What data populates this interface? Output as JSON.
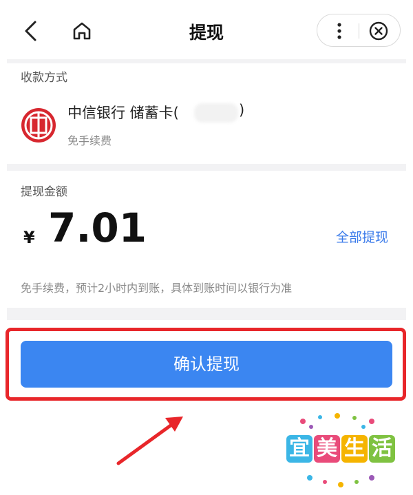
{
  "header": {
    "title": "提现",
    "back_icon": "chevron-left-icon",
    "home_icon": "home-icon",
    "more_icon": "more-vertical-icon",
    "close_icon": "close-circle-icon"
  },
  "payment_method": {
    "label": "收款方式",
    "bank_name": "中信银行 储蓄卡(",
    "bank_suffix": ")",
    "fee_note": "免手续费",
    "bank_logo": "citic-bank-logo"
  },
  "withdraw": {
    "label": "提现金额",
    "currency_symbol": "¥",
    "amount": "7.01",
    "withdraw_all_label": "全部提现",
    "arrival_note": "免手续费，预计2小时内到账，具体到账时间以银行为准"
  },
  "actions": {
    "confirm_label": "确认提现"
  },
  "watermark": {
    "chars": [
      "宜",
      "美",
      "生",
      "活"
    ]
  },
  "colors": {
    "accent": "#3b86f1",
    "link": "#3b7bea",
    "highlight": "#e8262a",
    "bank_red": "#d7272f"
  }
}
